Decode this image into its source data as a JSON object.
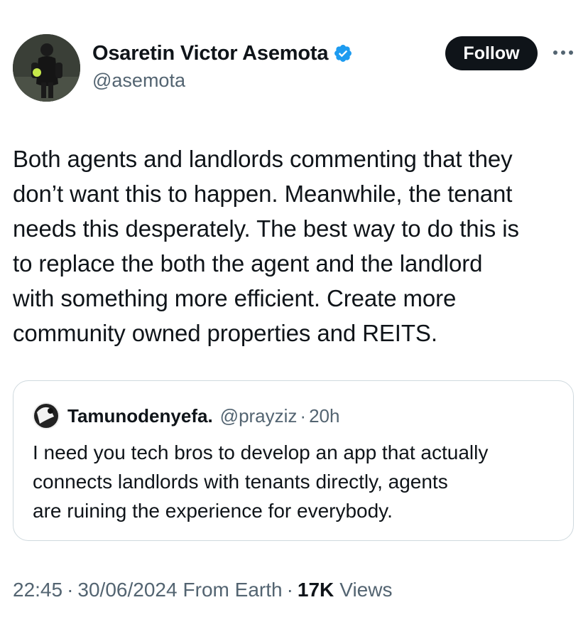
{
  "author": {
    "display_name": "Osaretin Victor Asemota",
    "handle": "@asemota",
    "avatar_icon": "profile-photo",
    "verified_icon": "verified-badge-icon",
    "verified_color": "#1d9bf0"
  },
  "actions": {
    "follow_label": "Follow",
    "more_icon": "more-horizontal-icon"
  },
  "tweet": {
    "text": "Both agents and landlords commenting that they\ndon’t want this to happen. Meanwhile, the tenant\nneeds this desperately. The best way to do this is\nto replace the both the agent and the landlord\nwith something more efficient. Create more\ncommunity owned properties and REITS."
  },
  "quote": {
    "display_name": "Tamunodenyefa.",
    "handle": "@prayziz",
    "separator": "·",
    "time": "20h",
    "text": "I need you tech bros to develop an app that actually\nconnects landlords with tenants directly,  agents\nare ruining the experience for everybody."
  },
  "meta": {
    "time": "22:45",
    "separator": "·",
    "date": "30/06/2024",
    "source": "From Earth",
    "views_count": "17K",
    "views_label": "Views"
  },
  "colors": {
    "text_primary": "#0f1419",
    "text_secondary": "#536471",
    "border": "#cfd9de",
    "accent": "#1d9bf0"
  }
}
